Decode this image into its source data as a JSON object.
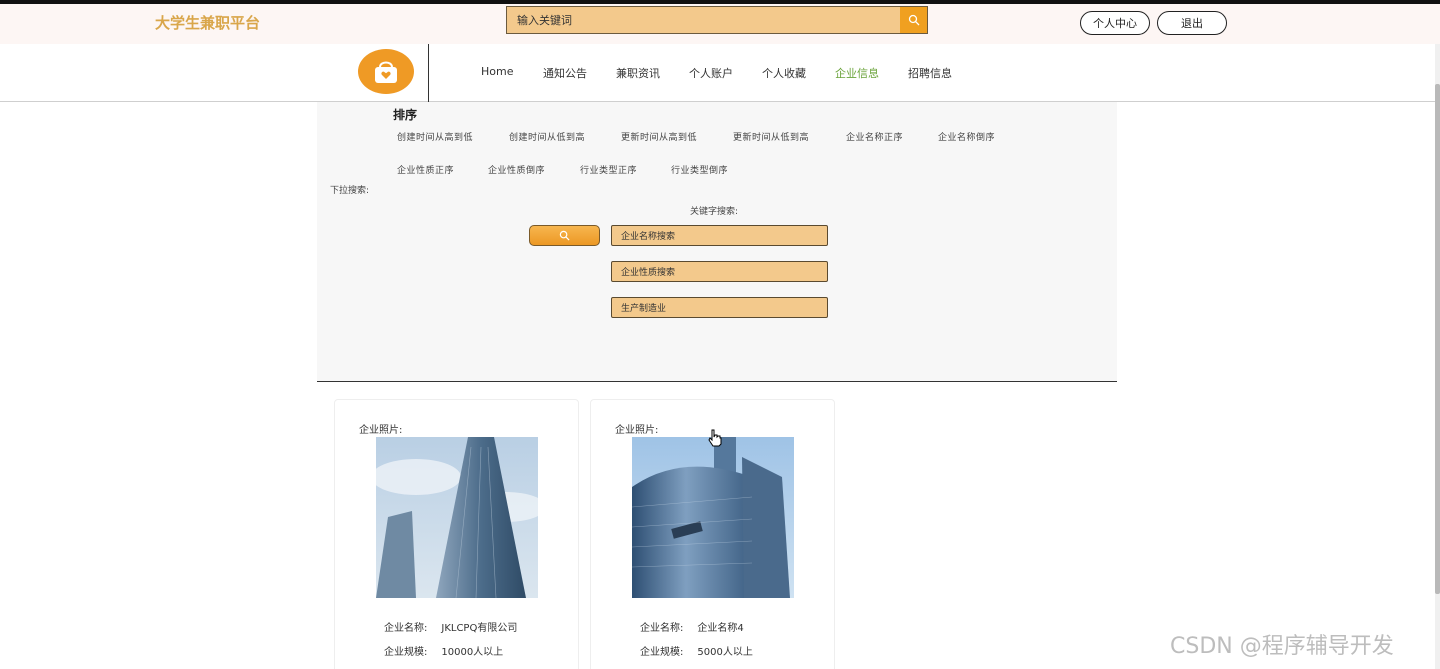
{
  "header": {
    "site_title": "大学生兼职平台",
    "search_placeholder": "输入关键词",
    "center_button": "个人中心",
    "logout_button": "退出"
  },
  "nav": {
    "items": [
      {
        "label": "Home",
        "active": false
      },
      {
        "label": "通知公告",
        "active": false
      },
      {
        "label": "兼职资讯",
        "active": false
      },
      {
        "label": "个人账户",
        "active": false
      },
      {
        "label": "个人收藏",
        "active": false
      },
      {
        "label": "企业信息",
        "active": true
      },
      {
        "label": "招聘信息",
        "active": false
      }
    ],
    "active_color": "#6aa33a"
  },
  "sort": {
    "title": "排序",
    "options": [
      "创建时间从高到低",
      "创建时间从低到高",
      "更新时间从高到低",
      "更新时间从低到高",
      "企业名称正序",
      "企业名称倒序",
      "企业性质正序",
      "企业性质倒序",
      "行业类型正序",
      "行业类型倒序"
    ]
  },
  "filter": {
    "dropdown_label": "下拉搜索:",
    "keyword_label": "关键字搜索:",
    "company_name_placeholder": "企业名称搜索",
    "company_nature_placeholder": "企业性质搜索",
    "industry_value": "生产制造业"
  },
  "cards": [
    {
      "photo_label": "企业照片:",
      "name_label": "企业名称:",
      "name_value": "JKLCPQ有限公司",
      "scale_label": "企业规模:",
      "scale_value": "10000人以上"
    },
    {
      "photo_label": "企业照片:",
      "name_label": "企业名称:",
      "name_value": "企业名称4",
      "scale_label": "企业规模:",
      "scale_value": "5000人以上"
    }
  ],
  "watermark": "CSDN @程序辅导开发",
  "colors": {
    "accent": "#ef9a25",
    "field_bg": "#f3c98c",
    "title_gold": "#d9a64a"
  }
}
